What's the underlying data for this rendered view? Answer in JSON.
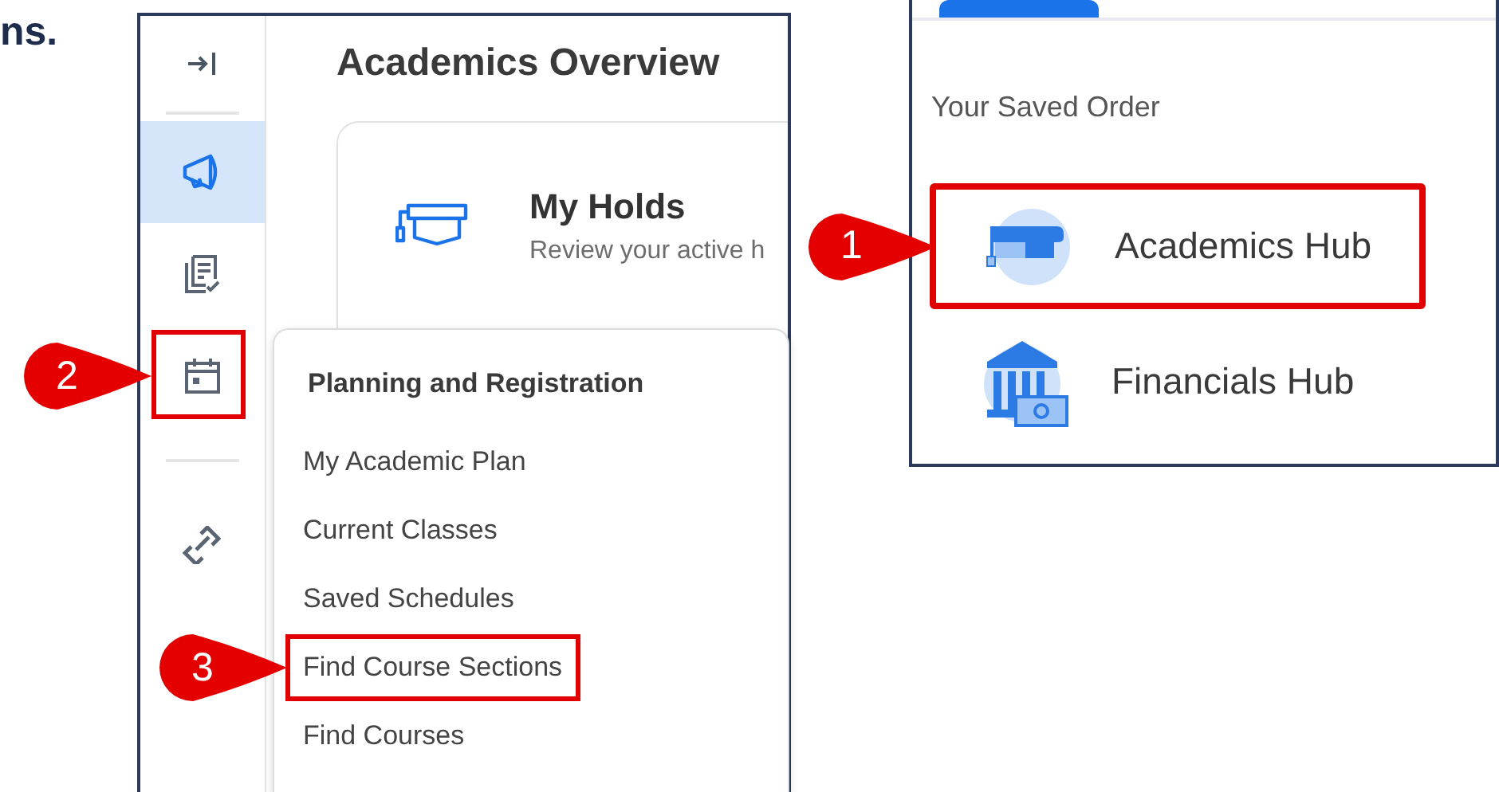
{
  "intro_text": "ns.",
  "left_panel": {
    "sidebar": {
      "items": [
        {
          "kind": "announcements",
          "selected": true,
          "highlighted": false
        },
        {
          "kind": "tasks",
          "selected": false,
          "highlighted": false
        },
        {
          "kind": "calendar",
          "selected": false,
          "highlighted": true,
          "callout": "2"
        },
        {
          "kind": "links",
          "selected": false,
          "highlighted": false
        }
      ]
    },
    "title": "Academics Overview",
    "card": {
      "title": "My Holds",
      "subtitle": "Review your active h"
    },
    "menu": {
      "heading": "Planning and Registration",
      "items": [
        {
          "label": "My Academic Plan",
          "highlighted": false
        },
        {
          "label": "Current Classes",
          "highlighted": false
        },
        {
          "label": "Saved Schedules",
          "highlighted": false
        },
        {
          "label": "Find Course Sections",
          "highlighted": true,
          "callout": "3"
        },
        {
          "label": "Find Courses",
          "highlighted": false
        }
      ]
    }
  },
  "right_panel": {
    "tabs": [
      {
        "selected": true
      }
    ],
    "section_title": "Your Saved Order",
    "hubs": [
      {
        "kind": "academics",
        "label": "Academics Hub",
        "highlighted": true,
        "callout": "1"
      },
      {
        "kind": "financials",
        "label": "Financials Hub",
        "highlighted": false
      }
    ]
  }
}
